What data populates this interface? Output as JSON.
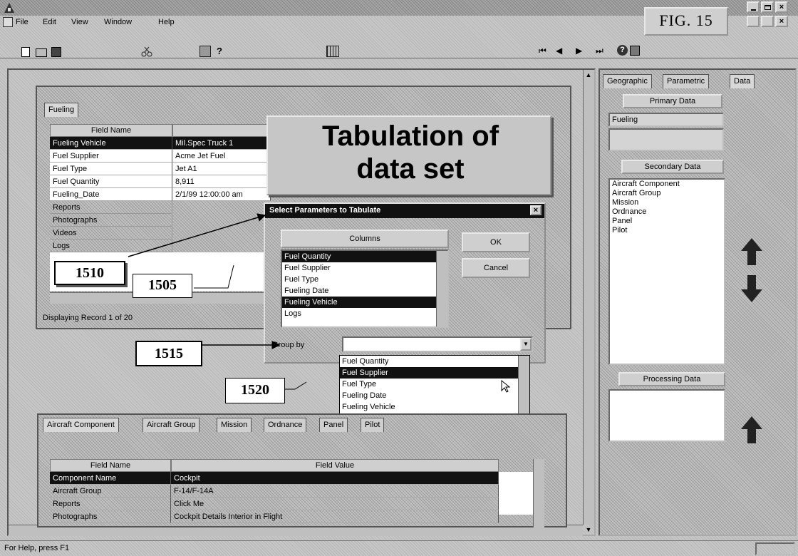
{
  "window": {
    "app_icon": "app-icon",
    "controls": [
      "minimize-icon",
      "restore-icon",
      "close-icon"
    ]
  },
  "menu": [
    "File",
    "Edit",
    "View",
    "Window",
    "Help"
  ],
  "figure_label": "FIG. 15",
  "record_nav": [
    "first-record-icon",
    "prev-record-icon",
    "next-record-icon",
    "last-record-icon",
    "help-icon",
    "context-help-icon"
  ],
  "record_window": {
    "tab": "Fueling",
    "col_header_name": "Field Name",
    "rows": [
      {
        "name": "Fueling Vehicle",
        "value": "Mil.Spec Truck 1"
      },
      {
        "name": "Fuel Supplier",
        "value": "Acme Jet Fuel"
      },
      {
        "name": "Fuel Type",
        "value": "Jet A1"
      },
      {
        "name": "Fuel Quantity",
        "value": "8,911"
      },
      {
        "name": "Fueling_Date",
        "value": "2/1/99 12:00:00 am"
      },
      {
        "name": "Reports",
        "value": ""
      },
      {
        "name": "Photographs",
        "value": ""
      },
      {
        "name": "Videos",
        "value": ""
      },
      {
        "name": "Logs",
        "value": ""
      }
    ],
    "status": "Displaying Record 1 of 20"
  },
  "tabulation_title": "Tabulation of data set",
  "dialog": {
    "title": "Select Parameters to Tabulate",
    "section_label": "Columns",
    "columns": [
      "Fuel Quantity",
      "Fuel Supplier",
      "Fuel Type",
      "Fueling Date",
      "Fueling Vehicle",
      "Logs"
    ],
    "selected": [
      0,
      4
    ],
    "ok_label": "OK",
    "cancel_label": "Cancel",
    "group_label": "Group by",
    "group_value": "",
    "dropdown_options": [
      "Fuel Quantity",
      "Fuel Supplier",
      "Fuel Type",
      "Fueling Date",
      "Fueling Vehicle"
    ],
    "dropdown_selected": 1
  },
  "callouts": [
    "1510",
    "1505",
    "1515",
    "1520"
  ],
  "bottom_window": {
    "tabs": [
      "Aircraft Component",
      "Aircraft Group",
      "Mission",
      "Ordnance",
      "Panel",
      "Pilot"
    ],
    "col_header_name": "Field Name",
    "col_header_value": "Field Value",
    "rows": [
      {
        "name": "Component Name",
        "value": "Cockpit"
      },
      {
        "name": "Aircraft Group",
        "value": "F-14/F-14A"
      },
      {
        "name": "Reports",
        "value": "Click Me"
      },
      {
        "name": "Photographs",
        "value": "Cockpit Details Interior in Flight"
      }
    ]
  },
  "side_panel": {
    "tabs": [
      "Geographic",
      "Parametric",
      "Data"
    ],
    "primary_header": "Primary Data",
    "primary_value": "Fueling",
    "secondary_header": "Secondary Data",
    "secondary_items": [
      "Aircraft Component",
      "Aircraft Group",
      "Mission",
      "Ordnance",
      "Panel",
      "Pilot"
    ],
    "processing_header": "Processing Data"
  },
  "status_bar": "For Help, press F1"
}
